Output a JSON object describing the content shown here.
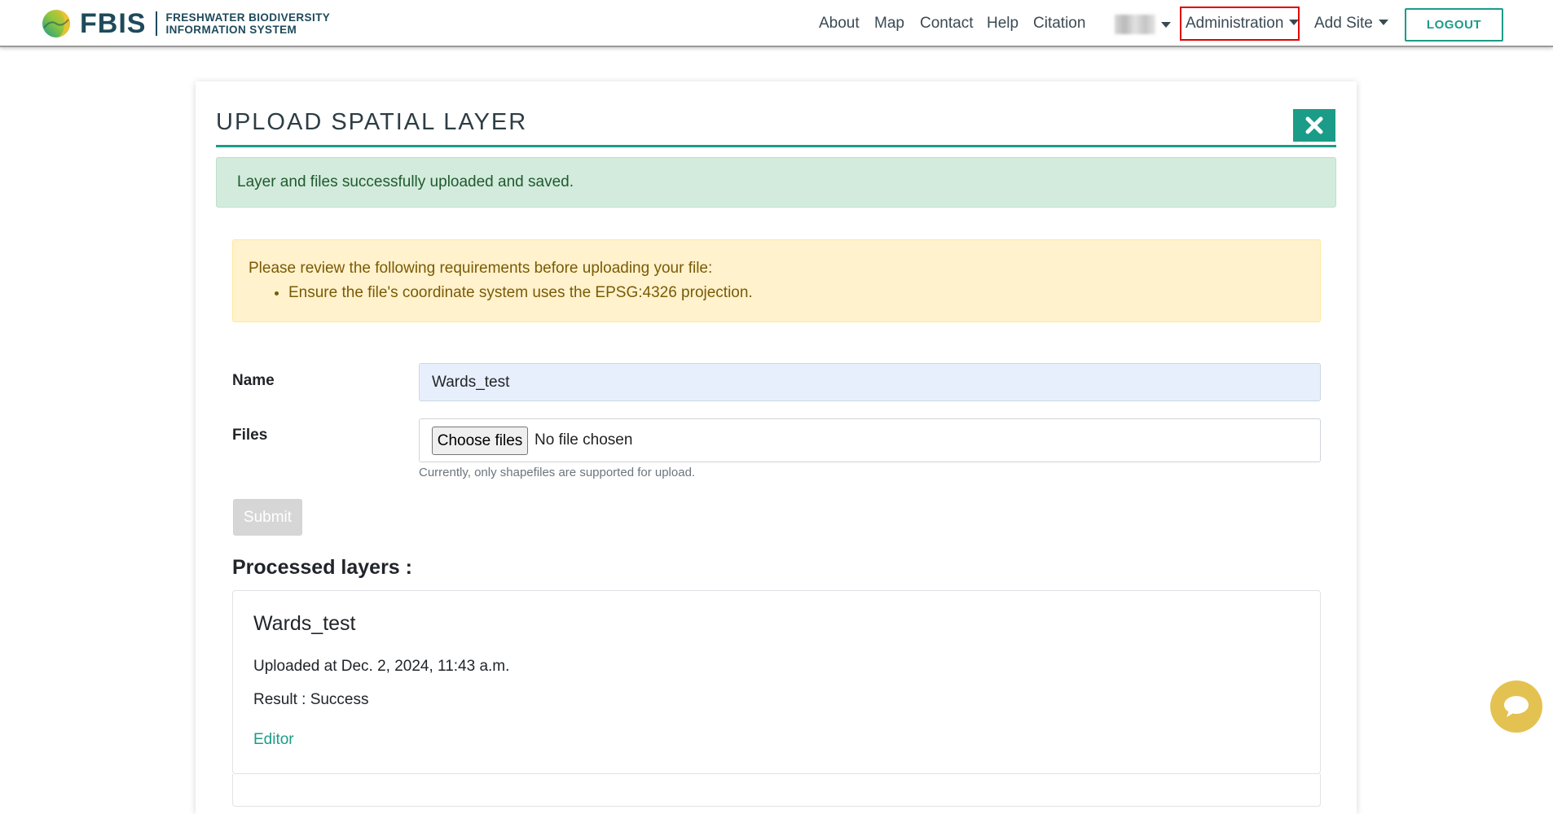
{
  "logo": {
    "word": "FBIS",
    "line1": "FRESHWATER BIODIVERSITY",
    "line2": "INFORMATION SYSTEM"
  },
  "nav": {
    "about": "About",
    "map": "Map",
    "contact": "Contact",
    "help": "Help",
    "citation": "Citation",
    "administration": "Administration",
    "add_site": "Add Site",
    "logout": "LOGOUT"
  },
  "page": {
    "title": "UPLOAD SPATIAL LAYER",
    "success_message": "Layer and files successfully uploaded and saved.",
    "requirements_intro": "Please review the following requirements before uploading your file:",
    "requirements": [
      "Ensure the file's coordinate system uses the EPSG:4326 projection."
    ]
  },
  "form": {
    "name_label": "Name",
    "name_value": "Wards_test",
    "files_label": "Files",
    "choose_files": "Choose files",
    "no_file": "No file chosen",
    "help_text": "Currently, only shapefiles are supported for upload.",
    "submit": "Submit"
  },
  "processed": {
    "heading": "Processed layers :",
    "layers": [
      {
        "name": "Wards_test",
        "uploaded": "Uploaded at Dec. 2, 2024, 11:43 a.m.",
        "result": "Result : Success",
        "link": "Editor"
      }
    ]
  },
  "colors": {
    "accent": "#1b9c88",
    "brand_dark": "#1e4a5a",
    "success_bg": "#d3ebdc",
    "warning_bg": "#fff2cc",
    "highlight_box": "#e00000",
    "chat_bubble": "#e4c251"
  },
  "icons": {
    "close": "close-x-icon",
    "chat": "chat-bubble-icon",
    "dropdown": "caret-down-icon"
  }
}
